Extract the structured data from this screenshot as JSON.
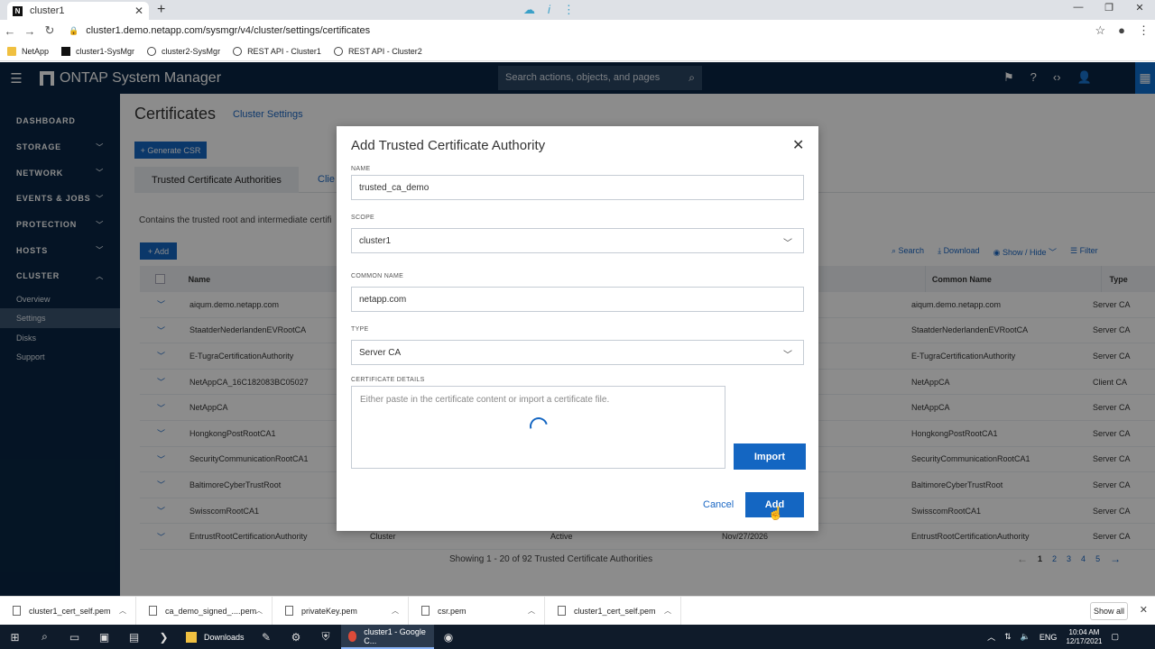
{
  "browser": {
    "tab_title": "cluster1",
    "tab_favicon": "N",
    "url": "cluster1.demo.netapp.com/sysmgr/v4/cluster/settings/certificates",
    "bookmarks": [
      "NetApp",
      "cluster1-SysMgr",
      "cluster2-SysMgr",
      "REST API - Cluster1",
      "REST API - Cluster2"
    ]
  },
  "app": {
    "title": "ONTAP System Manager",
    "search_placeholder": "Search actions, objects, and pages"
  },
  "sidebar": {
    "sections": [
      "DASHBOARD",
      "STORAGE",
      "NETWORK",
      "EVENTS & JOBS",
      "PROTECTION",
      "HOSTS",
      "CLUSTER"
    ],
    "sub_items": [
      "Overview",
      "Settings",
      "Disks",
      "Support"
    ]
  },
  "page": {
    "title": "Certificates",
    "cluster_settings_link": "Cluster Settings",
    "generate_csr": "+ Generate CSR",
    "tab_trusted": "Trusted Certificate Authorities",
    "tab_client": "Clie",
    "description": "Contains the trusted root and intermediate certifi",
    "add_label": "+ Add",
    "toolbar": {
      "search": "Search",
      "download": "Download",
      "show_hide": "Show / Hide",
      "filter": "Filter"
    },
    "columns": {
      "name": "Name",
      "common_name": "Common Name",
      "type": "Type"
    },
    "rows": [
      {
        "name": "aiqum.demo.netapp.com",
        "scope": "",
        "status": "",
        "expiry": "",
        "common": "aiqum.demo.netapp.com",
        "type": "Server CA"
      },
      {
        "name": "StaatderNederlandenEVRootCA",
        "scope": "",
        "status": "",
        "expiry": "",
        "common": "StaatderNederlandenEVRootCA",
        "type": "Server CA"
      },
      {
        "name": "E-TugraCertificationAuthority",
        "scope": "",
        "status": "",
        "expiry": "",
        "common": "E-TugraCertificationAuthority",
        "type": "Server CA"
      },
      {
        "name": "NetAppCA_16C182083BC05027",
        "scope": "",
        "status": "",
        "expiry": "",
        "common": "NetAppCA",
        "type": "Client CA"
      },
      {
        "name": "NetAppCA",
        "scope": "",
        "status": "",
        "expiry": "",
        "common": "NetAppCA",
        "type": "Server CA"
      },
      {
        "name": "HongkongPostRootCA1",
        "scope": "",
        "status": "",
        "expiry": "",
        "common": "HongkongPostRootCA1",
        "type": "Server CA"
      },
      {
        "name": "SecurityCommunicationRootCA1",
        "scope": "",
        "status": "",
        "expiry": "",
        "common": "SecurityCommunicationRootCA1",
        "type": "Server CA"
      },
      {
        "name": "BaltimoreCyberTrustRoot",
        "scope": "",
        "status": "",
        "expiry": "",
        "common": "BaltimoreCyberTrustRoot",
        "type": "Server CA"
      },
      {
        "name": "SwisscomRootCA1",
        "scope": "",
        "status": "",
        "expiry": "",
        "common": "SwisscomRootCA1",
        "type": "Server CA"
      },
      {
        "name": "EntrustRootCertificationAuthority",
        "scope": "Cluster",
        "status": "Active",
        "expiry": "Nov/27/2026",
        "common": "EntrustRootCertificationAuthority",
        "type": "Server CA"
      }
    ],
    "paging_text": "Showing 1 - 20 of 92 Trusted Certificate Authorities",
    "pages": [
      "1",
      "2",
      "3",
      "4",
      "5"
    ]
  },
  "modal": {
    "title": "Add Trusted Certificate Authority",
    "name_label": "NAME",
    "name_value": "trusted_ca_demo",
    "scope_label": "SCOPE",
    "scope_value": "cluster1",
    "common_name_label": "COMMON NAME",
    "common_name_value": "netapp.com",
    "type_label": "TYPE",
    "type_value": "Server CA",
    "details_label": "CERTIFICATE DETAILS",
    "details_placeholder": "Either paste in the certificate content or import a certificate file.",
    "import_label": "Import",
    "cancel_label": "Cancel",
    "add_label": "Add"
  },
  "downloads": {
    "files": [
      "cluster1_cert_self.pem",
      "ca_demo_signed_....pem",
      "privateKey.pem",
      "csr.pem",
      "cluster1_cert_self.pem"
    ],
    "show_all": "Show all"
  },
  "taskbar": {
    "downloads_label": "Downloads",
    "chrome_label": "cluster1 - Google C...",
    "lang": "ENG",
    "time": "10:04 AM",
    "date": "12/17/2021"
  },
  "colors": {
    "header": "#0a2644",
    "accent": "#1466c2"
  }
}
